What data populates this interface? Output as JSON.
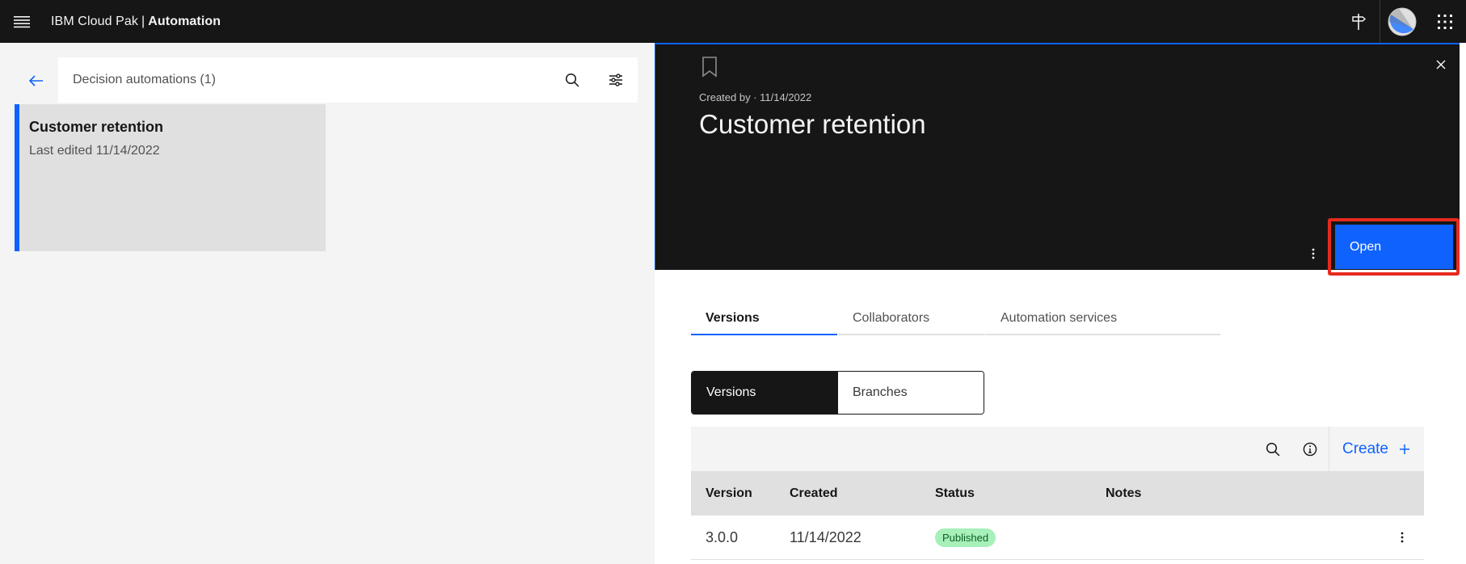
{
  "header": {
    "brand_prefix": "IBM Cloud Pak",
    "brand_separator": "|",
    "brand_product": "Automation"
  },
  "left": {
    "search_label": "Decision automations (1)",
    "cards": [
      {
        "title": "Customer retention",
        "subtitle": "Last edited 11/14/2022"
      }
    ]
  },
  "detail": {
    "created_by": "Created by · 11/14/2022",
    "title": "Customer retention",
    "open_label": "Open",
    "tabs": [
      {
        "label": "Versions"
      },
      {
        "label": "Collaborators"
      },
      {
        "label": "Automation services"
      }
    ],
    "switcher": [
      {
        "label": "Versions"
      },
      {
        "label": "Branches"
      }
    ],
    "toolbar": {
      "create_label": "Create"
    },
    "table": {
      "columns": [
        "Version",
        "Created",
        "Status",
        "Notes"
      ],
      "rows": [
        {
          "version": "3.0.0",
          "created": "11/14/2022",
          "status": "Published",
          "notes": ""
        }
      ]
    }
  },
  "colors": {
    "accent": "#0f62fe",
    "highlight": "#e62a1e",
    "status_published_bg": "#a7f0ba"
  }
}
